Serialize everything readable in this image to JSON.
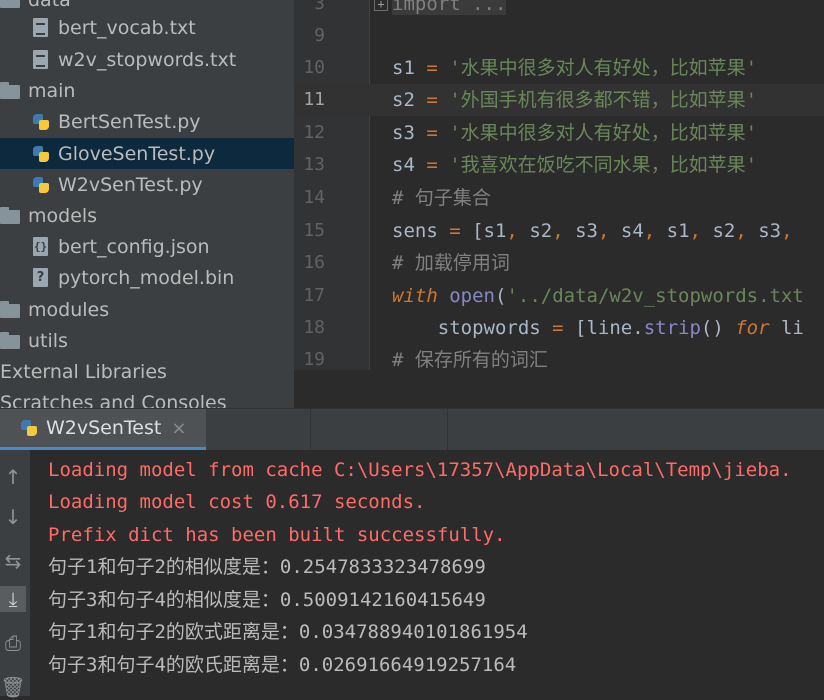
{
  "project_tree": {
    "items": [
      {
        "label": "data",
        "icon": "folder-icon",
        "indent": 0
      },
      {
        "label": "bert_vocab.txt",
        "icon": "text-file-icon",
        "indent": 1
      },
      {
        "label": "w2v_stopwords.txt",
        "icon": "text-file-icon",
        "indent": 1
      },
      {
        "label": "main",
        "icon": "folder-icon",
        "indent": 0
      },
      {
        "label": "BertSenTest.py",
        "icon": "python-file-icon",
        "indent": 1
      },
      {
        "label": "GloveSenTest.py",
        "icon": "python-file-icon",
        "indent": 1,
        "selected": true
      },
      {
        "label": "W2vSenTest.py",
        "icon": "python-file-icon",
        "indent": 1
      },
      {
        "label": "models",
        "icon": "folder-icon",
        "indent": 0
      },
      {
        "label": "bert_config.json",
        "icon": "json-file-icon",
        "indent": 1
      },
      {
        "label": "pytorch_model.bin",
        "icon": "binary-file-icon",
        "indent": 1
      },
      {
        "label": "modules",
        "icon": "folder-icon",
        "indent": 0
      },
      {
        "label": "utils",
        "icon": "folder-icon",
        "indent": 0
      },
      {
        "label": "External Libraries",
        "icon": "",
        "indent": 0
      },
      {
        "label": "Scratches and Consoles",
        "icon": "",
        "indent": 0
      }
    ]
  },
  "editor": {
    "current_line": "11",
    "lines": [
      {
        "num": "3",
        "tokens": [
          {
            "t": "import ...",
            "c": "c-fold"
          }
        ]
      },
      {
        "num": "9",
        "tokens": []
      },
      {
        "num": "10",
        "tokens": [
          {
            "t": "s1 ",
            "c": ""
          },
          {
            "t": "=",
            "c": "c-op"
          },
          {
            "t": " '水果中很多对人有好处，比如苹果'",
            "c": "c-str"
          }
        ]
      },
      {
        "num": "11",
        "tokens": [
          {
            "t": "s2 ",
            "c": ""
          },
          {
            "t": "=",
            "c": "c-op"
          },
          {
            "t": " '外国手机有很多都不错，比如苹果'",
            "c": "c-str"
          }
        ]
      },
      {
        "num": "12",
        "tokens": [
          {
            "t": "s3 ",
            "c": ""
          },
          {
            "t": "=",
            "c": "c-op"
          },
          {
            "t": " '水果中很多对人有好处，比如苹果'",
            "c": "c-str"
          }
        ]
      },
      {
        "num": "13",
        "tokens": [
          {
            "t": "s4 ",
            "c": ""
          },
          {
            "t": "=",
            "c": "c-op"
          },
          {
            "t": " '我喜欢在饭吃不同水果，比如苹果'",
            "c": "c-str"
          }
        ]
      },
      {
        "num": "14",
        "tokens": [
          {
            "t": "# 句子集合",
            "c": "c-cmt"
          }
        ]
      },
      {
        "num": "15",
        "tokens": [
          {
            "t": "sens ",
            "c": ""
          },
          {
            "t": "=",
            "c": "c-op"
          },
          {
            "t": " [s1",
            "c": ""
          },
          {
            "t": ",",
            "c": "c-op"
          },
          {
            "t": " s2",
            "c": ""
          },
          {
            "t": ",",
            "c": "c-op"
          },
          {
            "t": " s3",
            "c": ""
          },
          {
            "t": ",",
            "c": "c-op"
          },
          {
            "t": " s4",
            "c": ""
          },
          {
            "t": ",",
            "c": "c-op"
          },
          {
            "t": " s1",
            "c": ""
          },
          {
            "t": ",",
            "c": "c-op"
          },
          {
            "t": " s2",
            "c": ""
          },
          {
            "t": ",",
            "c": "c-op"
          },
          {
            "t": " s3",
            "c": ""
          },
          {
            "t": ",",
            "c": "c-op"
          }
        ]
      },
      {
        "num": "16",
        "tokens": [
          {
            "t": "# 加载停用词",
            "c": "c-cmt"
          }
        ]
      },
      {
        "num": "17",
        "tokens": [
          {
            "t": "with",
            "c": "c-kw"
          },
          {
            "t": " ",
            "c": ""
          },
          {
            "t": "open",
            "c": "c-bi"
          },
          {
            "t": "(",
            "c": ""
          },
          {
            "t": "'../data/w2v_stopwords.txt",
            "c": "c-str"
          }
        ]
      },
      {
        "num": "18",
        "tokens": [
          {
            "t": "    stopwords ",
            "c": ""
          },
          {
            "t": "=",
            "c": "c-op"
          },
          {
            "t": " [line.",
            "c": ""
          },
          {
            "t": "strip",
            "c": "c-bi"
          },
          {
            "t": "() ",
            "c": ""
          },
          {
            "t": "for",
            "c": "c-kw"
          },
          {
            "t": " li",
            "c": ""
          }
        ]
      },
      {
        "num": "19",
        "tokens": [
          {
            "t": "# 保存所有的词汇",
            "c": "c-cmt"
          }
        ]
      }
    ]
  },
  "run_window": {
    "tab_label": "W2vSenTest",
    "tab_close": "×",
    "toolbar_icons": [
      "arrow-up-icon",
      "arrow-down-icon",
      "soft-wrap-icon",
      "scroll-to-end-icon",
      "print-icon",
      "delete-icon"
    ],
    "output": [
      {
        "text": "Loading model from cache C:\\Users\\17357\\AppData\\Local\\Temp\\jieba.",
        "kind": "err"
      },
      {
        "text": "Loading model cost 0.617 seconds.",
        "kind": "err"
      },
      {
        "text": "Prefix dict has been built successfully.",
        "kind": "err"
      },
      {
        "text": "句子1和句子2的相似度是：0.2547833323478699",
        "kind": "norm"
      },
      {
        "text": "句子3和句子4的相似度是：0.5009142160415649",
        "kind": "norm"
      },
      {
        "text": "句子1和句子2的欧式距离是：0.03478894010186195​4",
        "kind": "norm"
      },
      {
        "text": "句子3和句子4的欧氏距离是：0.02691664919257164",
        "kind": "norm"
      }
    ]
  }
}
